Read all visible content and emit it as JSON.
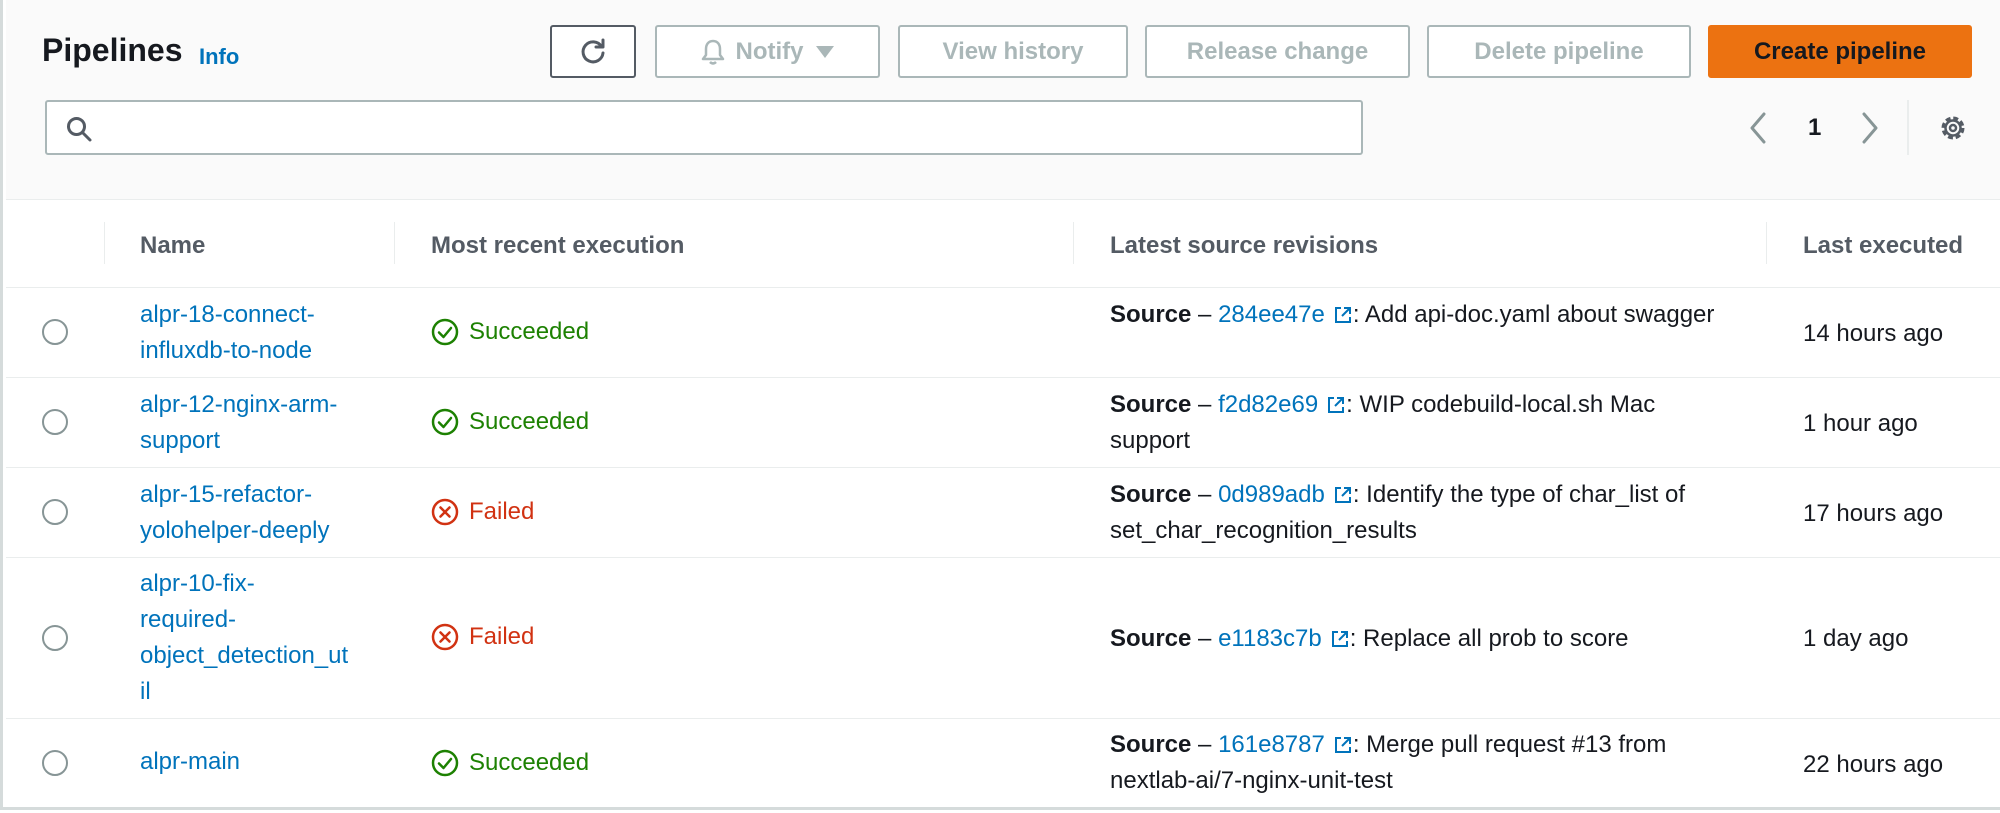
{
  "header": {
    "title": "Pipelines",
    "info_label": "Info"
  },
  "toolbar": {
    "notify_label": "Notify",
    "view_history_label": "View history",
    "release_change_label": "Release change",
    "delete_label": "Delete pipeline",
    "create_label": "Create pipeline"
  },
  "search": {
    "value": "",
    "placeholder": ""
  },
  "pagination": {
    "current_page": "1"
  },
  "table": {
    "columns": [
      "Name",
      "Most recent execution",
      "Latest source revisions",
      "Last executed"
    ],
    "rows": [
      {
        "name": "alpr-18-connect-influxdb-to-node",
        "status": "Succeeded",
        "status_type": "success",
        "source_label": "Source",
        "source_sep": " – ",
        "commit": "284ee47e",
        "message": ": Add api-doc.yaml about swagger",
        "last_executed": "14 hours ago"
      },
      {
        "name": "alpr-12-nginx-arm-support",
        "status": "Succeeded",
        "status_type": "success",
        "source_label": "Source",
        "source_sep": " – ",
        "commit": "f2d82e69",
        "message": ": WIP codebuild-local.sh Mac support",
        "last_executed": "1 hour ago"
      },
      {
        "name": "alpr-15-refactor-yolohelper-deeply",
        "status": "Failed",
        "status_type": "failed",
        "source_label": "Source",
        "source_sep": " – ",
        "commit": "0d989adb",
        "message": ": Identify the type of char_list of set_char_recognition_results",
        "last_executed": "17 hours ago"
      },
      {
        "name": "alpr-10-fix-required-object_detection_util",
        "status": "Failed",
        "status_type": "failed",
        "source_label": "Source",
        "source_sep": " – ",
        "commit": "e1183c7b",
        "message": ": Replace all prob to score",
        "last_executed": "1 day ago"
      },
      {
        "name": "alpr-main",
        "status": "Succeeded",
        "status_type": "success",
        "source_label": "Source",
        "source_sep": " – ",
        "commit": "161e8787",
        "message": ": Merge pull request #13 from nextlab-ai/7-nginx-unit-test",
        "last_executed": "22 hours ago"
      }
    ]
  },
  "icons": {
    "refresh": "refresh-icon",
    "notify": "bell-icon",
    "dropdown": "caret-down-icon",
    "search": "search-icon",
    "prev": "chevron-left-icon",
    "next": "chevron-right-icon",
    "settings": "gear-icon",
    "success": "check-circle-icon",
    "failed": "x-circle-icon",
    "external": "external-link-icon"
  },
  "colors": {
    "link": "#0073bb",
    "success": "#1d8102",
    "failed": "#d13212",
    "primary_button": "#ec7211",
    "disabled_text": "#aab7b8"
  }
}
